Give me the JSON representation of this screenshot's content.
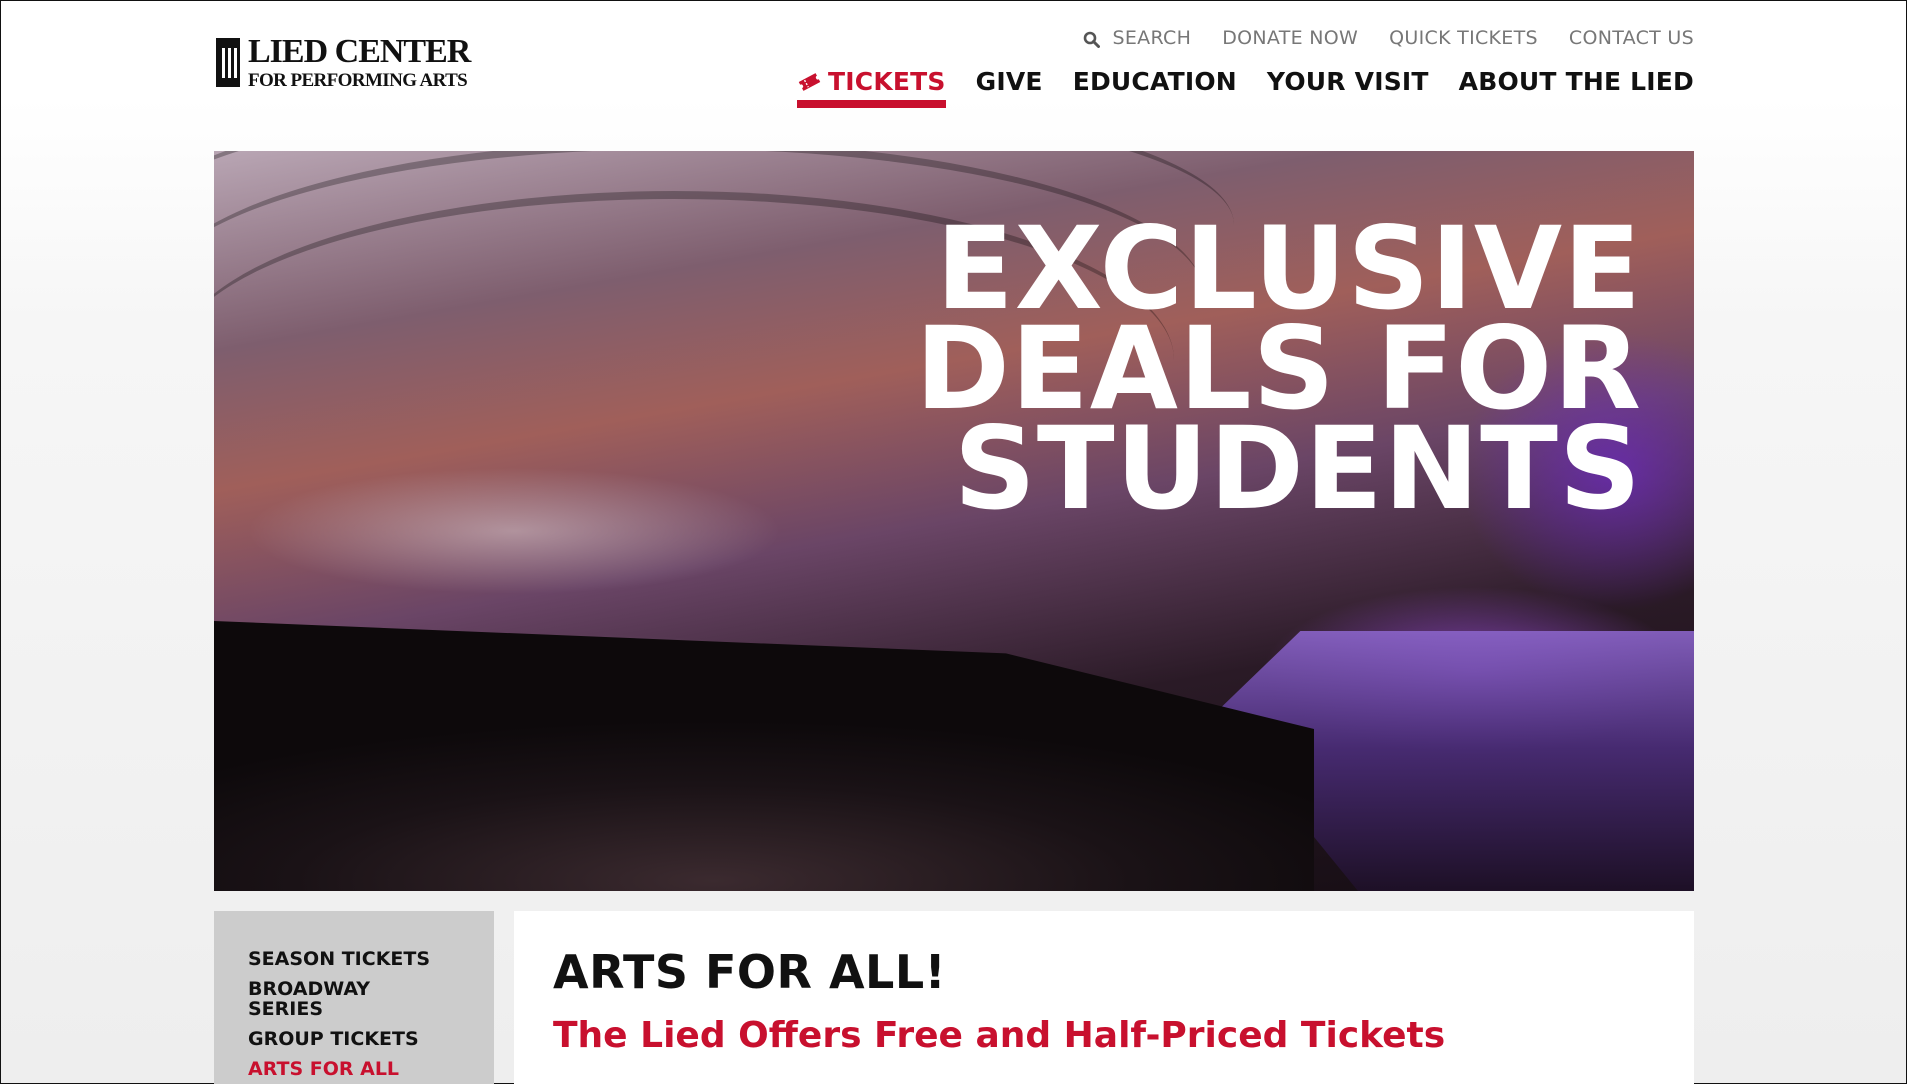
{
  "logo": {
    "line1": "LIED CENTER",
    "line2": "FOR PERFORMING ARTS"
  },
  "util_nav": {
    "search_label": "SEARCH",
    "donate_label": "DONATE NOW",
    "quick_tickets_label": "QUICK TICKETS",
    "contact_label": "CONTACT US"
  },
  "main_nav": {
    "tickets": "TICKETS",
    "give": "GIVE",
    "education": "EDUCATION",
    "your_visit": "YOUR VISIT",
    "about": "ABOUT THE LIED"
  },
  "hero": {
    "headline": "EXCLUSIVE\nDEALS FOR\nSTUDENTS"
  },
  "sidebar": {
    "items": [
      {
        "label": "SEASON TICKETS",
        "active": false
      },
      {
        "label": "BROADWAY SERIES",
        "active": false
      },
      {
        "label": "GROUP TICKETS",
        "active": false
      },
      {
        "label": "ARTS FOR ALL",
        "active": true
      }
    ]
  },
  "content": {
    "title": "ARTS FOR ALL!",
    "subtitle": "The Lied Offers Free and Half-Priced Tickets"
  },
  "colors": {
    "accent": "#c8102e",
    "text": "#111111",
    "muted": "#777777",
    "sidebar_bg": "#cccccc"
  },
  "icons": {
    "search": "search-icon",
    "ticket": "ticket-icon"
  }
}
